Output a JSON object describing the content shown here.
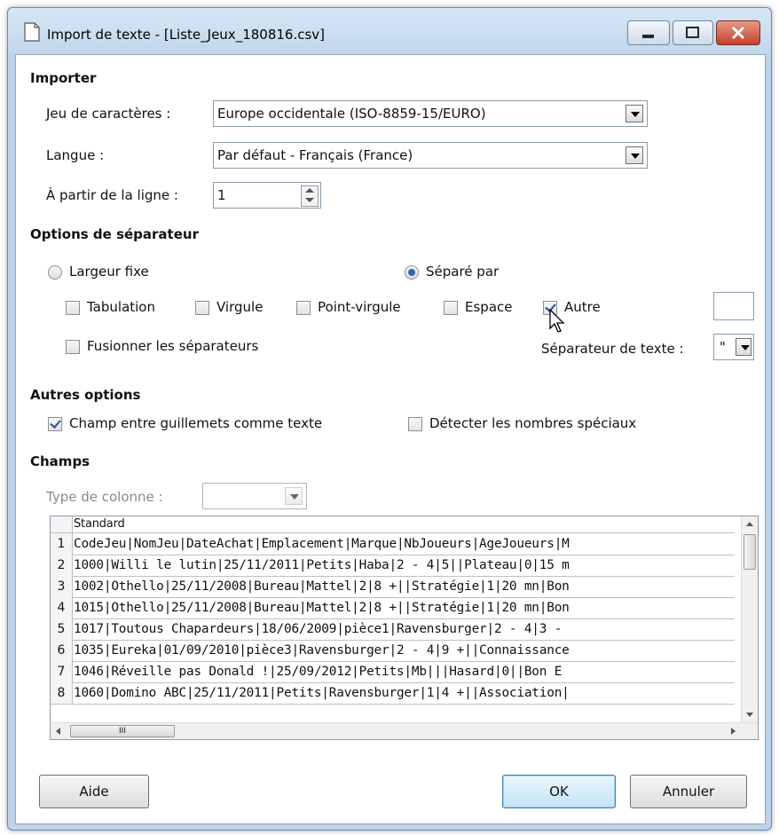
{
  "window": {
    "title": "Import de texte - [Liste_Jeux_180816.csv]"
  },
  "importer": {
    "heading": "Importer",
    "charset_label": "Jeu de caractères :",
    "charset_value": "Europe occidentale (ISO-8859-15/EURO)",
    "language_label": "Langue :",
    "language_value": "Par défaut - Français (France)",
    "from_line_label": "À partir de la ligne :",
    "from_line_value": "1"
  },
  "separator": {
    "heading": "Options de séparateur",
    "fixed_width_label": "Largeur fixe",
    "fixed_width_selected": false,
    "separated_by_label": "Séparé par",
    "separated_by_selected": true,
    "tab_label": "Tabulation",
    "tab_checked": false,
    "comma_label": "Virgule",
    "comma_checked": false,
    "semicolon_label": "Point-virgule",
    "semicolon_checked": false,
    "space_label": "Espace",
    "space_checked": false,
    "other_label": "Autre",
    "other_checked": true,
    "other_value": "",
    "merge_label": "Fusionner les séparateurs",
    "merge_checked": false,
    "text_sep_label": "Séparateur de texte :",
    "text_sep_value": "\""
  },
  "other_options": {
    "heading": "Autres options",
    "quoted_as_text_label": "Champ entre guillemets comme texte",
    "quoted_as_text_checked": true,
    "detect_special_label": "Détecter les nombres spéciaux",
    "detect_special_checked": false
  },
  "fields": {
    "heading": "Champs",
    "column_type_label": "Type de colonne :",
    "column_type_value": "",
    "column_header": "Standard",
    "rows": [
      {
        "num": "1",
        "text": "CodeJeu|NomJeu|DateAchat|Emplacement|Marque|NbJoueurs|AgeJoueurs|M"
      },
      {
        "num": "2",
        "text": "1000|Willi le lutin|25/11/2011|Petits|Haba|2 - 4|5||Plateau|0|15 m"
      },
      {
        "num": "3",
        "text": "1002|Othello|25/11/2008|Bureau|Mattel|2|8 +||Stratégie|1|20 mn|Bon"
      },
      {
        "num": "4",
        "text": "1015|Othello|25/11/2008|Bureau|Mattel|2|8 +||Stratégie|1|20 mn|Bon"
      },
      {
        "num": "5",
        "text": "1017|Toutous Chapardeurs|18/06/2009|pièce1|Ravensburger|2 - 4|3 -"
      },
      {
        "num": "6",
        "text": "1035|Eureka|01/09/2010|pièce3|Ravensburger|2 - 4|9 +||Connaissance"
      },
      {
        "num": "7",
        "text": "1046|Réveille pas Donald !|25/09/2012|Petits|Mb|||Hasard|0||Bon E"
      },
      {
        "num": "8",
        "text": "1060|Domino ABC|25/11/2011|Petits|Ravensburger|1|4 +||Association|"
      }
    ],
    "hscroll_thumb_glyph": "III"
  },
  "buttons": {
    "help": "Aide",
    "ok": "OK",
    "cancel": "Annuler"
  }
}
